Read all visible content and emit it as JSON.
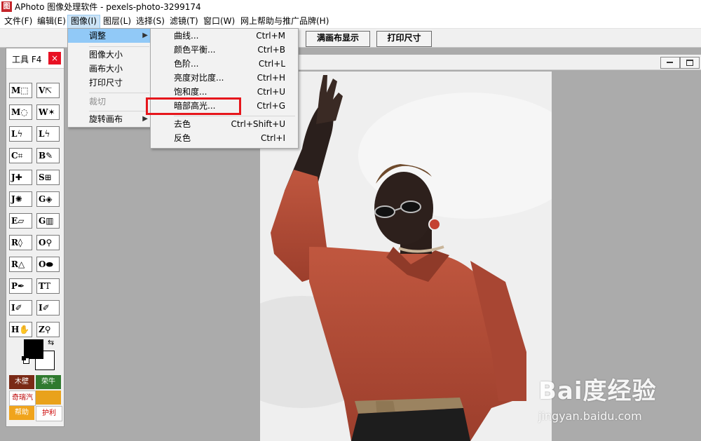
{
  "window": {
    "icon_text": "图",
    "title": "APhoto 图像处理软件 - pexels-photo-3299174"
  },
  "menubar": {
    "items": [
      {
        "label": "文件(F)"
      },
      {
        "label": "编辑(E)"
      },
      {
        "label": "图像(I)"
      },
      {
        "label": "图层(L)"
      },
      {
        "label": "选择(S)"
      },
      {
        "label": "滤镜(T)"
      },
      {
        "label": "窗口(W)"
      },
      {
        "label": "网上帮助与推广品牌(H)"
      }
    ]
  },
  "toolbar": {
    "fit_canvas_label": "满画布显示",
    "print_size_label": "打印尺寸"
  },
  "image_menu": {
    "items": [
      {
        "label": "调整",
        "has_submenu": true
      },
      {
        "label": "图像大小"
      },
      {
        "label": "画布大小"
      },
      {
        "label": "打印尺寸"
      },
      {
        "label": "裁切"
      },
      {
        "label": "旋转画布",
        "has_submenu": true
      }
    ]
  },
  "adjust_menu": {
    "items": [
      {
        "label": "曲线...",
        "shortcut": "Ctrl+M"
      },
      {
        "label": "颜色平衡...",
        "shortcut": "Ctrl+B"
      },
      {
        "label": "色阶...",
        "shortcut": "Ctrl+L"
      },
      {
        "label": "亮度对比度...",
        "shortcut": "Ctrl+H"
      },
      {
        "label": "饱和度...",
        "shortcut": "Ctrl+U"
      },
      {
        "label": "暗部高光...",
        "shortcut": "Ctrl+G"
      },
      {
        "label": "去色",
        "shortcut": "Ctrl+Shift+U"
      },
      {
        "label": "反色",
        "shortcut": "Ctrl+I"
      }
    ]
  },
  "tool_panel": {
    "title": "工具 F4",
    "close": "×",
    "tools": [
      {
        "key": "M",
        "glyph": "⬚"
      },
      {
        "key": "V",
        "glyph": "⇱"
      },
      {
        "key": "M",
        "glyph": "◌"
      },
      {
        "key": "W",
        "glyph": "✶"
      },
      {
        "key": "L",
        "glyph": "ϟ"
      },
      {
        "key": "L",
        "glyph": "ϟ"
      },
      {
        "key": "C",
        "glyph": "⌗"
      },
      {
        "key": "B",
        "glyph": "✎"
      },
      {
        "key": "J",
        "glyph": "✚"
      },
      {
        "key": "S",
        "glyph": "⊞"
      },
      {
        "key": "J",
        "glyph": "✺"
      },
      {
        "key": "G",
        "glyph": "◈"
      },
      {
        "key": "E",
        "glyph": "▱"
      },
      {
        "key": "G",
        "glyph": "▥"
      },
      {
        "key": "R",
        "glyph": "◊"
      },
      {
        "key": "O",
        "glyph": "⚲"
      },
      {
        "key": "R",
        "glyph": "△"
      },
      {
        "key": "O",
        "glyph": "⬬"
      },
      {
        "key": "P",
        "glyph": "✒"
      },
      {
        "key": "T",
        "glyph": "T"
      },
      {
        "key": "I",
        "glyph": "✐"
      },
      {
        "key": "I",
        "glyph": "✐"
      },
      {
        "key": "H",
        "glyph": "✋"
      },
      {
        "key": "Z",
        "glyph": "⚲"
      }
    ],
    "swap_icon": "⇆",
    "ads": [
      "木壁",
      "荣牛",
      "奇瑞汽车",
      "",
      "帮助",
      "护利"
    ],
    "colors": {
      "foreground": "#000000",
      "background": "#ffffff"
    }
  },
  "watermark": {
    "brand": "Bai度经验",
    "site": "jingyan.baidu.com"
  },
  "colors": {
    "menu_highlight": "#91c9f7",
    "annotation_red": "#e6161c",
    "workspace_gray": "#ababab"
  }
}
